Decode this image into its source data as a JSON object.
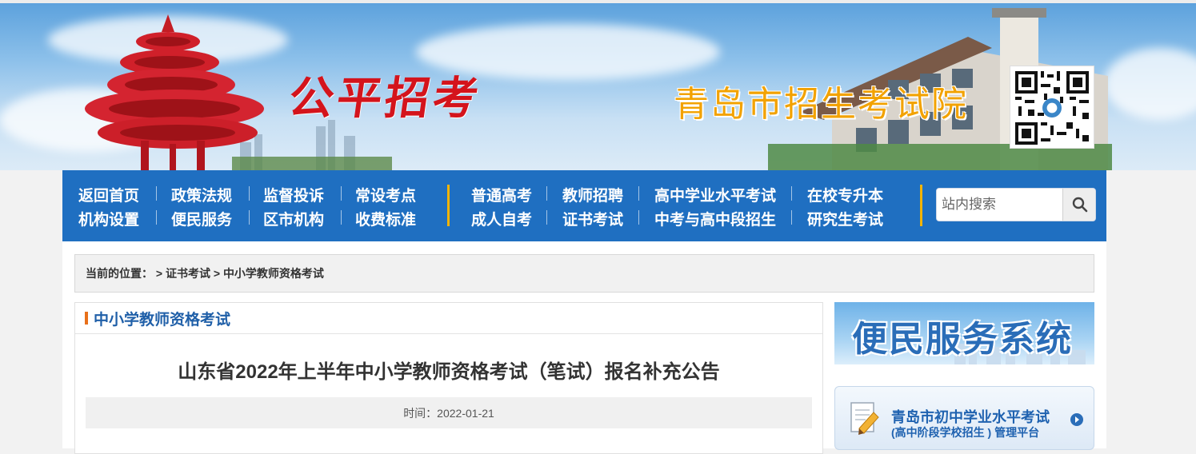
{
  "banner": {
    "calligraphy": "公平招考",
    "org_title": "青岛市招生考试院"
  },
  "nav": {
    "left_row1": [
      "返回首页",
      "政策法规",
      "监督投诉",
      "常设考点"
    ],
    "left_row2": [
      "机构设置",
      "便民服务",
      "区市机构",
      "收费标准"
    ],
    "right_row1": [
      "普通高考",
      "教师招聘",
      "高中学业水平考试",
      "在校专升本"
    ],
    "right_row2": [
      "成人自考",
      "证书考试",
      "中考与高中段招生",
      "研究生考试"
    ],
    "search_placeholder": "站内搜索"
  },
  "breadcrumb": {
    "label": "当前的位置：",
    "sep1": " > ",
    "item1": "证书考试",
    "sep2": " > ",
    "item2": "中小学教师资格考试"
  },
  "panel": {
    "heading": "中小学教师资格考试",
    "article_title": "山东省2022年上半年中小学教师资格考试（笔试）报名补充公告",
    "time": "时间：2022-01-21"
  },
  "sidebar": {
    "banner_text": "便民服务系统",
    "card_line1": "青岛市初中学业水平考试",
    "card_line2": "(高中阶段学校招生 ) 管理平台"
  },
  "colors": {
    "nav_bg": "#1f6fc1",
    "nav_divider": "#f5b400",
    "heading_blue": "#1f5fa8",
    "heading_mark": "#e8701a",
    "org_title": "#f2a200",
    "calligraphy": "#d4141c"
  }
}
